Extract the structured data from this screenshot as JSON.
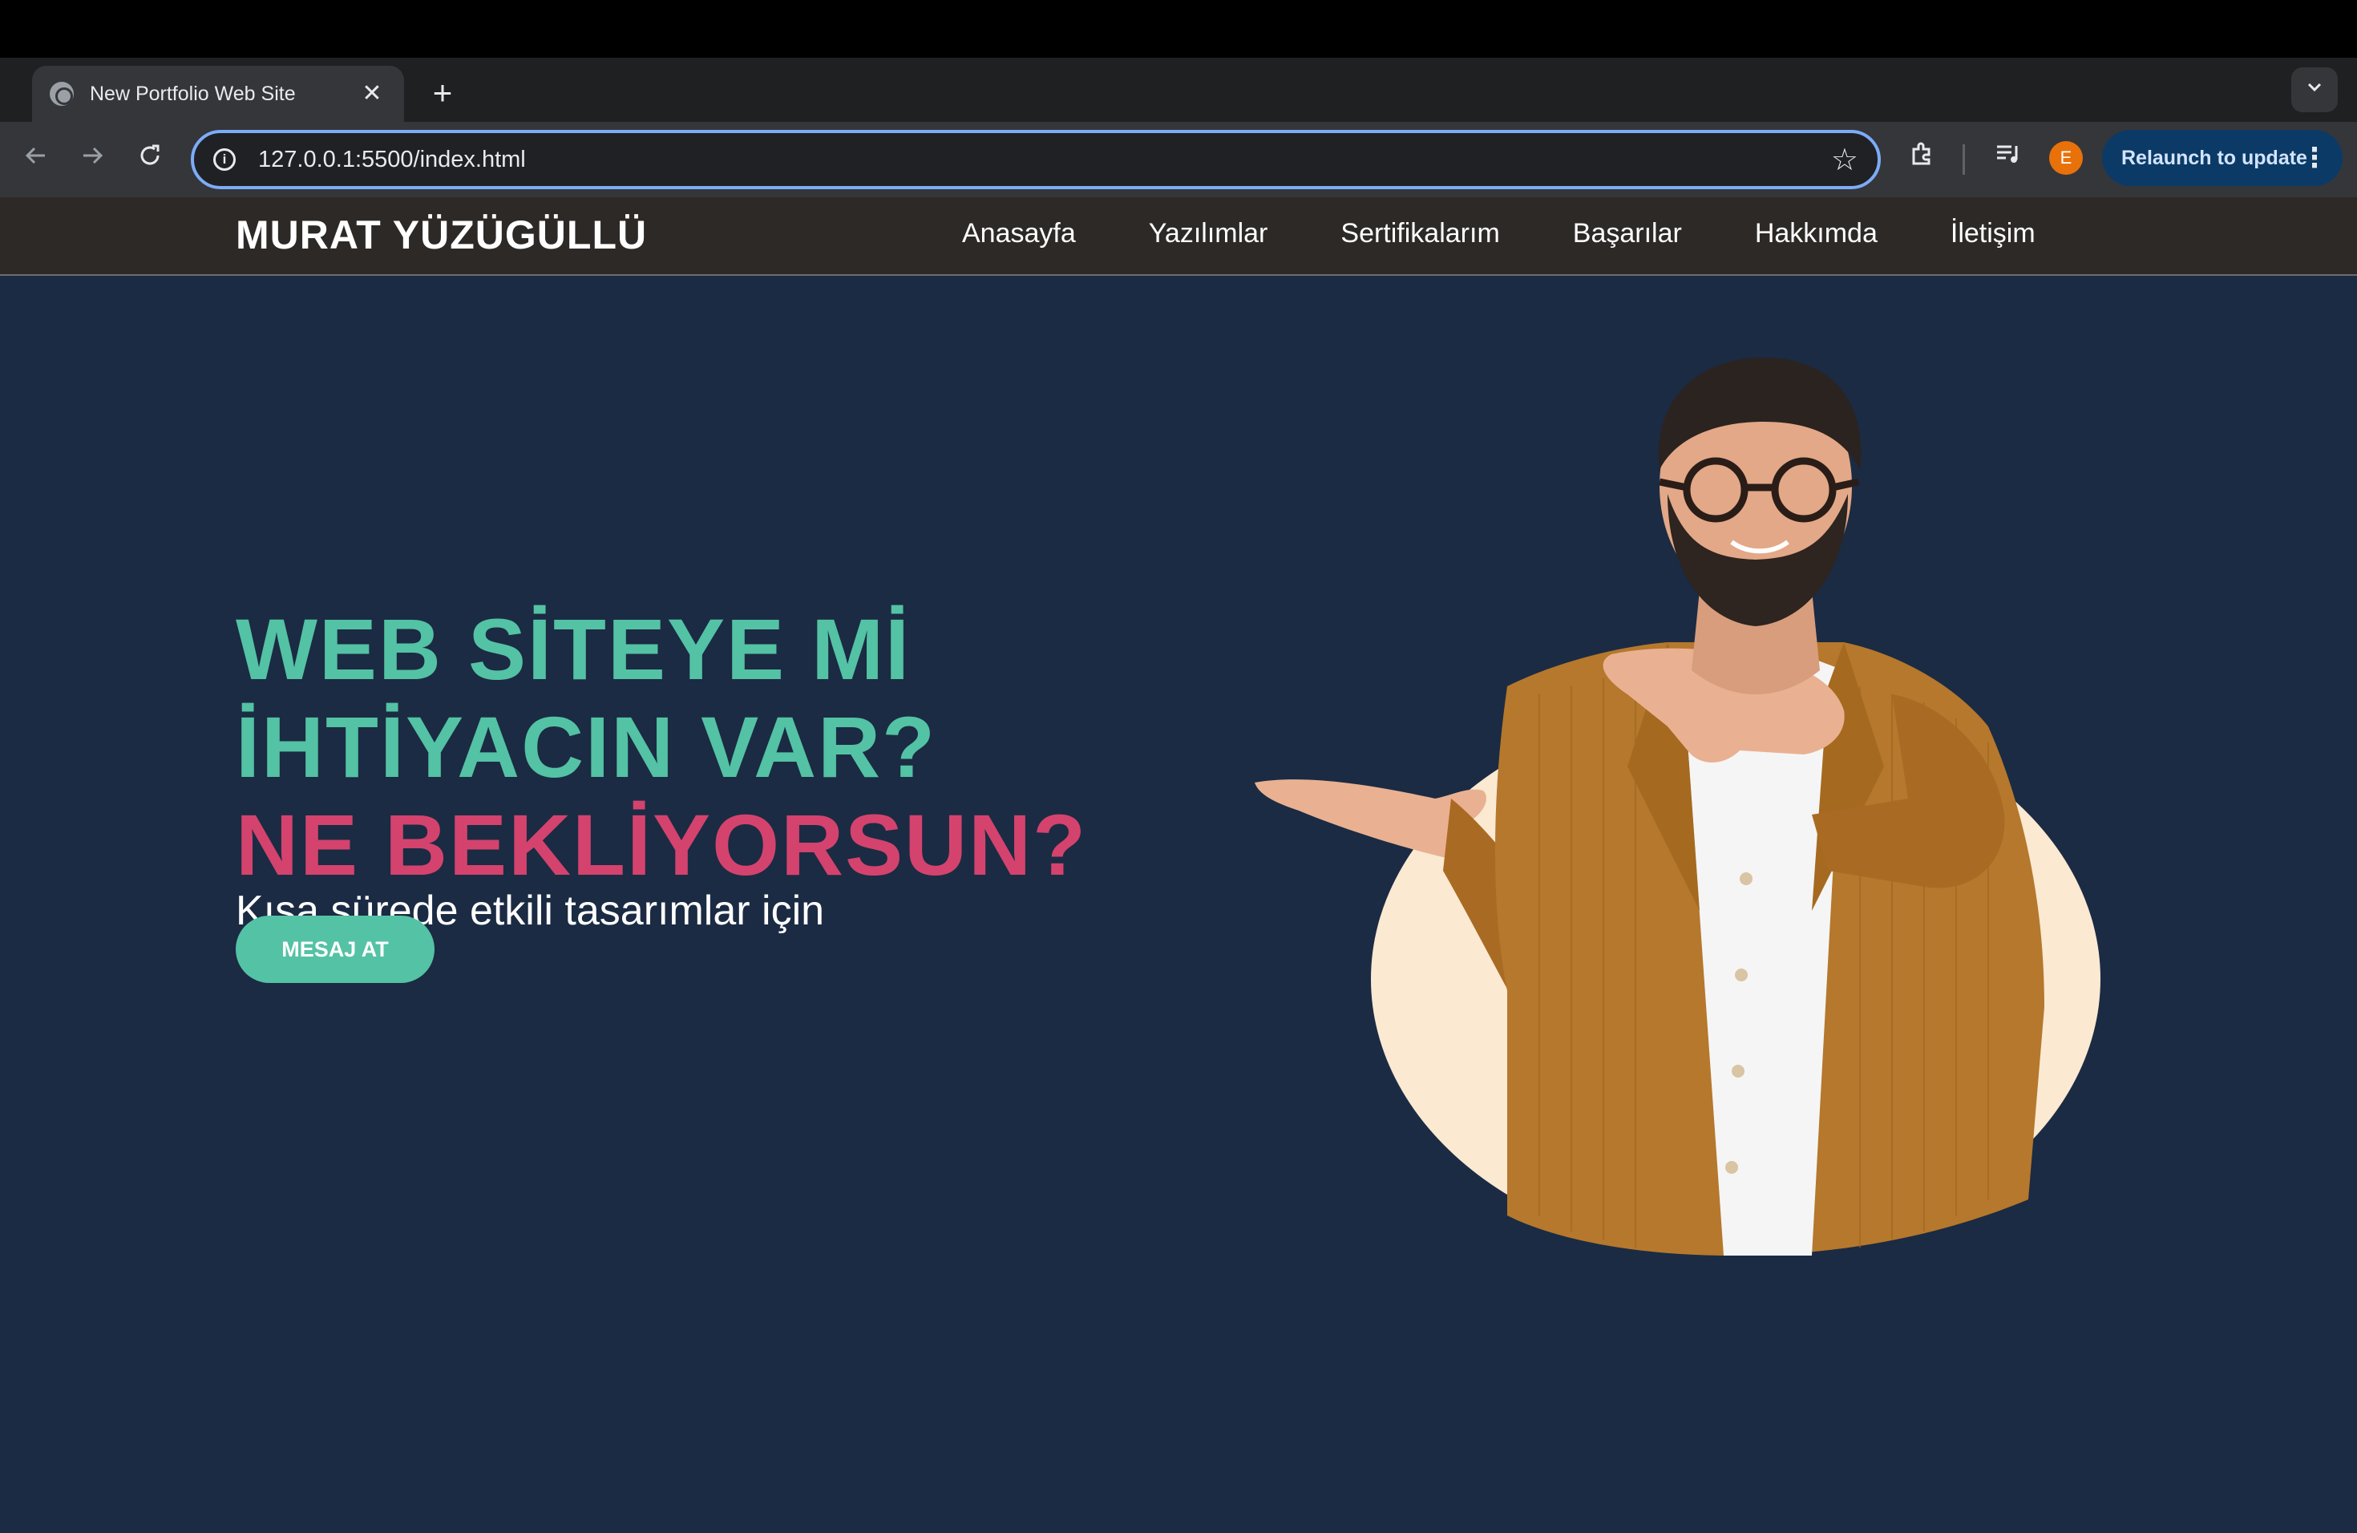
{
  "browser": {
    "tab_title": "New Portfolio Web Site",
    "tab_close": "✕",
    "new_tab": "+",
    "tab_list": "⌄",
    "url": "127.0.0.1:5500/index.html",
    "profile_initial": "E",
    "relaunch_label": "Relaunch to update",
    "icons": [
      "back-icon",
      "forward-icon",
      "reload-icon",
      "info-icon",
      "star-icon",
      "extensions-icon",
      "media-icon",
      "more-icon"
    ]
  },
  "site": {
    "brand": "MURAT YÜZÜGÜLLÜ",
    "nav": [
      "Anasayfa",
      "Yazılımlar",
      "Sertifikalarım",
      "Başarılar",
      "Hakkımda",
      "İletişim"
    ],
    "hero": {
      "line1": "WEB SİTEYE Mİ",
      "line2": "İHTİYACIN VAR?",
      "line3": "NE BEKLİYORSUN?",
      "subtitle": "Kısa sürede etkili tasarımlar için",
      "cta": "MESAJ AT"
    },
    "colors": {
      "background": "#1b2b43",
      "nav_background": "#2d2927",
      "accent_green": "#54c2a4",
      "accent_pink": "#d3436e",
      "circle": "#fbe9d2",
      "jacket": "#b5782c"
    }
  }
}
